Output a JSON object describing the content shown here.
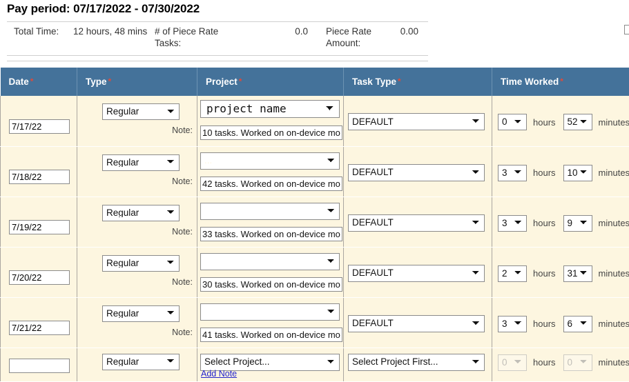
{
  "header": {
    "pay_period_label": "Pay period: 07/17/2022 - 07/30/2022"
  },
  "summary": {
    "total_time_label": "Total Time:",
    "total_time_value": "12 hours, 48 mins",
    "piece_rate_tasks_label": "# of Piece Rate Tasks:",
    "piece_rate_tasks_value": "0.0",
    "piece_rate_amount_label": "Piece Rate Amount:",
    "piece_rate_amount_value": "0.00"
  },
  "table": {
    "columns": [
      {
        "label": "Date",
        "required": "*"
      },
      {
        "label": "Type",
        "required": "*"
      },
      {
        "label": "Project",
        "required": "*"
      },
      {
        "label": "Task Type",
        "required": "*"
      },
      {
        "label": "Time Worked",
        "required": "*"
      }
    ],
    "note_label": "Note:",
    "hours_label": "hours",
    "minutes_label": "minutes",
    "add_note_label": "Add Note",
    "rows": [
      {
        "date": "7/17/22",
        "type": "Regular",
        "project": "project name",
        "note": "10 tasks. Worked on on-device mo",
        "task_type": "DEFAULT",
        "hours": "0",
        "minutes": "52"
      },
      {
        "date": "7/18/22",
        "type": "Regular",
        "project": "...",
        "note": "42 tasks. Worked on on-device mo",
        "task_type": "DEFAULT",
        "hours": "3",
        "minutes": "10"
      },
      {
        "date": "7/19/22",
        "type": "Regular",
        "project": "",
        "note": "33 tasks. Worked on on-device mo",
        "task_type": "DEFAULT",
        "hours": "3",
        "minutes": "9"
      },
      {
        "date": "7/20/22",
        "type": "Regular",
        "project": "",
        "note": "30 tasks. Worked on on-device mo",
        "task_type": "DEFAULT",
        "hours": "2",
        "minutes": "31"
      },
      {
        "date": "7/21/22",
        "type": "Regular",
        "project": "",
        "note": "41 tasks. Worked on on-device mo",
        "task_type": "DEFAULT",
        "hours": "3",
        "minutes": "6"
      }
    ],
    "new_row": {
      "date": "",
      "type": "Regular",
      "project": "Select Project...",
      "task_type": "Select Project First...",
      "hours": "0",
      "minutes": "0"
    }
  },
  "colors": {
    "header_blue": "#44729a",
    "row_cream": "#fdf6e0",
    "required_red": "#e04a3a",
    "link_blue": "#2222cc"
  }
}
